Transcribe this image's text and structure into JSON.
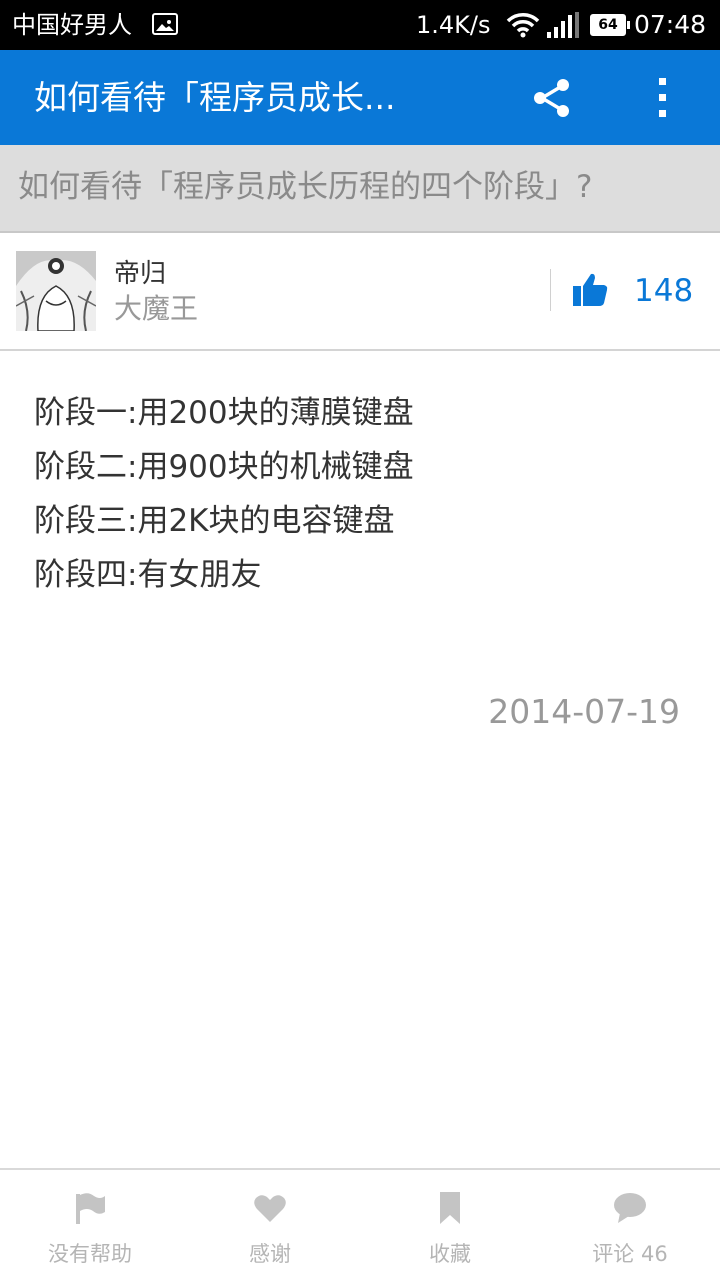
{
  "status_bar": {
    "carrier": "中国好男人",
    "speed": "1.4K/s",
    "battery": "64",
    "time": "07:48"
  },
  "app_bar": {
    "title": "如何看待「程序员成长...",
    "share_icon": "share-icon",
    "more_icon": "more-vert-icon"
  },
  "question": {
    "title": "如何看待「程序员成长历程的四个阶段」?"
  },
  "author": {
    "name": "帝归",
    "bio": "大魔王",
    "vote_count": "148",
    "vote_icon": "thumb-up-icon"
  },
  "answer": {
    "lines": [
      "阶段一:用200块的薄膜键盘",
      "阶段二:用900块的机械键盘",
      "阶段三:用2K块的电容键盘",
      "阶段四:有女朋友"
    ],
    "date": "2014-07-19"
  },
  "bottom_bar": {
    "items": [
      {
        "label": "没有帮助",
        "icon": "flag-icon"
      },
      {
        "label": "感谢",
        "icon": "heart-icon"
      },
      {
        "label": "收藏",
        "icon": "bookmark-icon"
      },
      {
        "label": "评论 46",
        "icon": "comment-icon"
      }
    ]
  },
  "colors": {
    "accent": "#0a78d7",
    "status_bar": "#000000",
    "question_bg": "#dddddd",
    "muted_text": "#999999",
    "bottom_icon": "#c4c4c4"
  }
}
